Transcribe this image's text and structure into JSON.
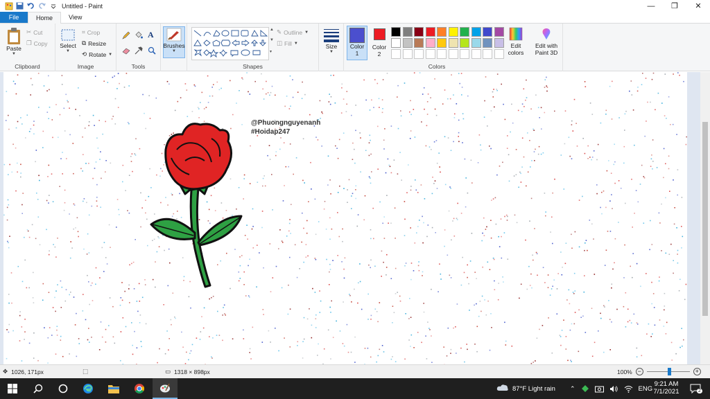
{
  "window": {
    "title": "Untitled - Paint",
    "minimize": "—",
    "maximize": "❐",
    "close": "✕"
  },
  "menu": {
    "file": "File",
    "home": "Home",
    "view": "View"
  },
  "ribbon": {
    "clipboard": {
      "paste": "Paste",
      "cut": "Cut",
      "copy": "Copy",
      "label": "Clipboard"
    },
    "image": {
      "select": "Select",
      "crop": "Crop",
      "resize": "Resize",
      "rotate": "Rotate",
      "label": "Image"
    },
    "tools": {
      "label": "Tools",
      "text_tool": "A"
    },
    "brushes": {
      "label": "Brushes"
    },
    "shapes": {
      "outline": "Outline",
      "fill": "Fill",
      "label": "Shapes"
    },
    "size": {
      "label": "Size"
    },
    "colors": {
      "color1_label": "Color",
      "color1_num": "1",
      "color2_label": "Color",
      "color2_num": "2",
      "edit_colors_line1": "Edit",
      "edit_colors_line2": "colors",
      "label": "Colors",
      "color1": "#4b4fce",
      "color2": "#ed1c24",
      "palette_row1": [
        "#000000",
        "#7f7f7f",
        "#880015",
        "#ed1c24",
        "#ff7f27",
        "#fff200",
        "#22b14c",
        "#00a2e8",
        "#3f48cc",
        "#a349a4"
      ],
      "palette_row2": [
        "#ffffff",
        "#c3c3c3",
        "#b97a57",
        "#ffaec9",
        "#ffc90e",
        "#efe4b0",
        "#b5e61d",
        "#99d9ea",
        "#7092be",
        "#c8bfe7"
      ]
    },
    "paint3d": {
      "line1": "Edit with",
      "line2": "Paint 3D"
    }
  },
  "canvas": {
    "text_line1": "@Phuongnguyenanh",
    "text_line2": "#Hoidap247"
  },
  "status": {
    "cursor": "1026, 171px",
    "size": "1318 × 898px",
    "zoom": "100%"
  },
  "taskbar": {
    "weather": "87°F  Light rain",
    "lang": "ENG",
    "time": "9:21 AM",
    "date": "7/1/2021",
    "notif_count": "2"
  }
}
